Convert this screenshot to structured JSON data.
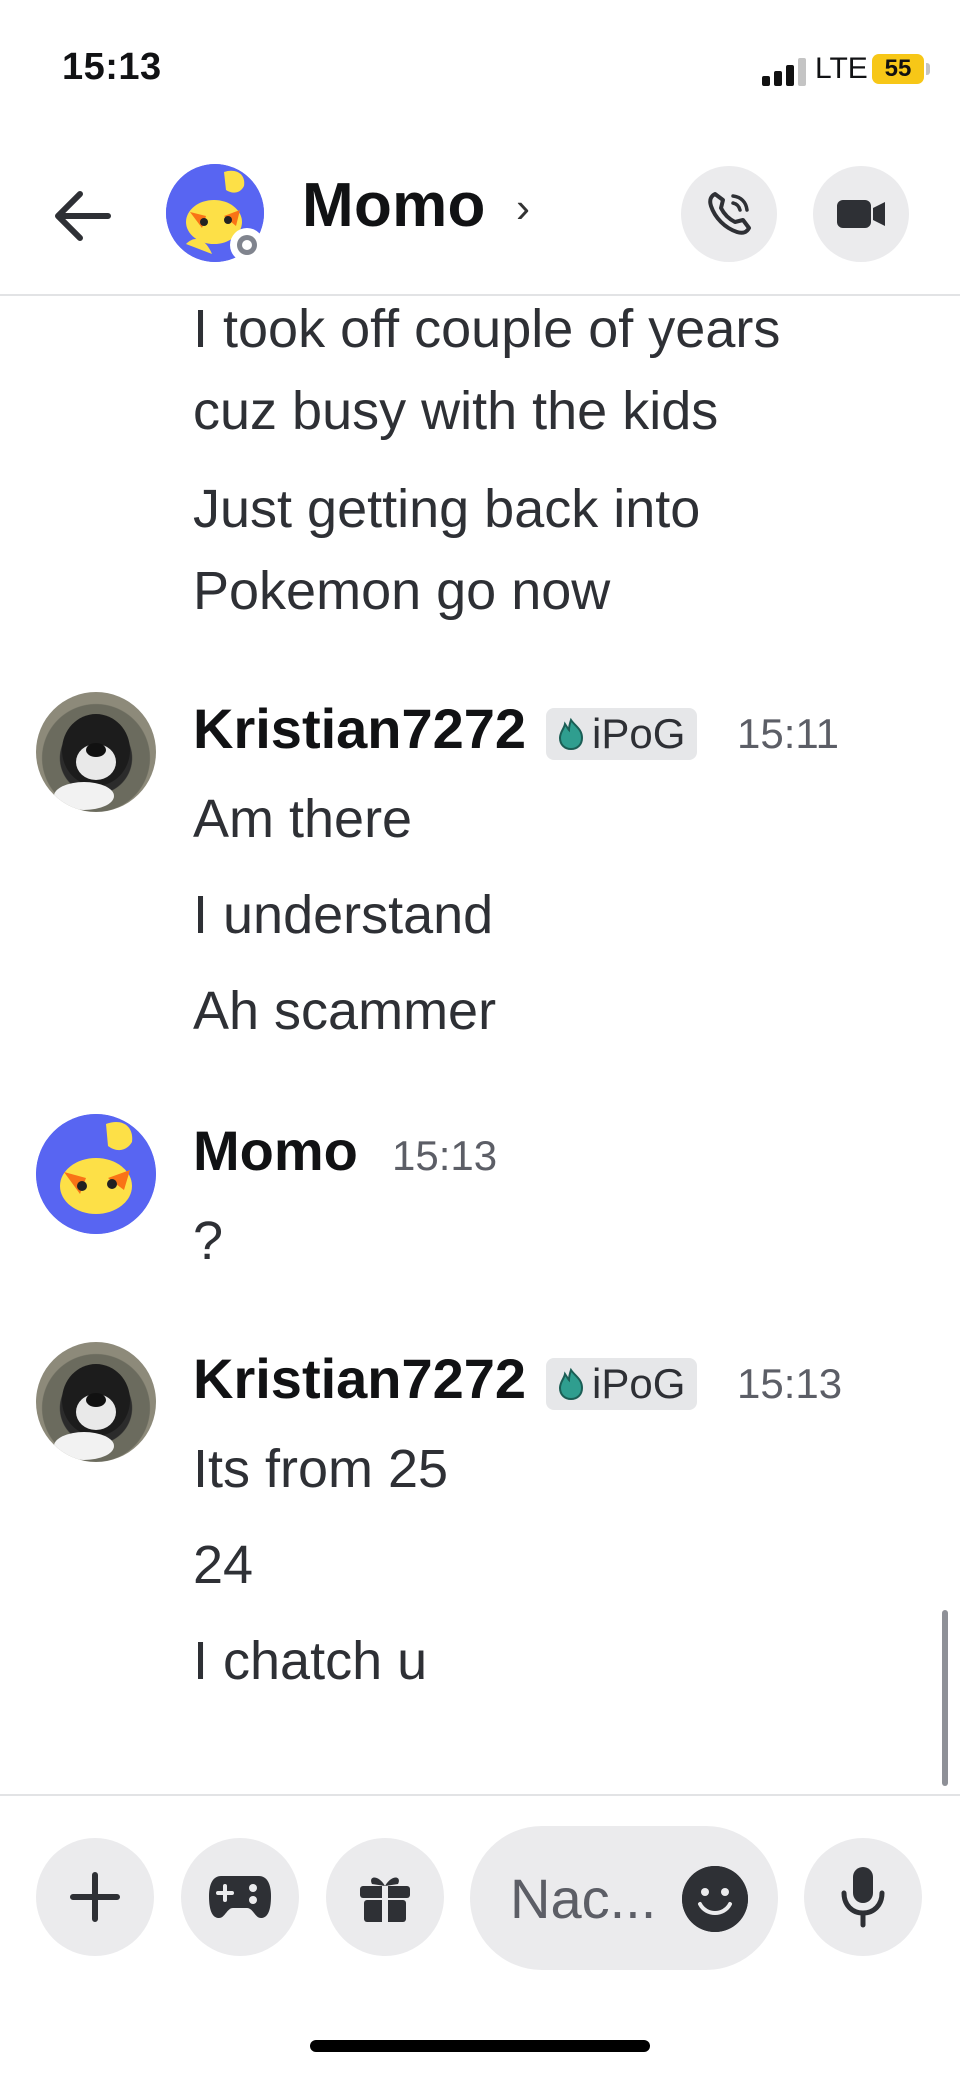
{
  "status_bar": {
    "time": "15:13",
    "network": "LTE",
    "battery": "55"
  },
  "header": {
    "title": "Momo",
    "chevron": "›"
  },
  "messages": {
    "continued_lines": [
      "I took off couple of years",
      "cuz busy with the kids",
      "Just getting back into",
      "Pokemon go now"
    ],
    "groups": [
      {
        "author": "Kristian7272",
        "badge": "iPoG",
        "time": "15:11",
        "lines": [
          "Am there",
          "I understand",
          "Ah scammer"
        ]
      },
      {
        "author": "Momo",
        "time": "15:13",
        "lines": [
          "?"
        ]
      },
      {
        "author": "Kristian7272",
        "badge": "iPoG",
        "time": "15:13",
        "lines": [
          "Its from 25",
          "24",
          "I chatch u"
        ]
      }
    ]
  },
  "composer": {
    "placeholder": "Nac..."
  },
  "colors": {
    "accent": "#5865f2",
    "battery": "#f7c717",
    "badge_bg": "#e6e7e9"
  }
}
